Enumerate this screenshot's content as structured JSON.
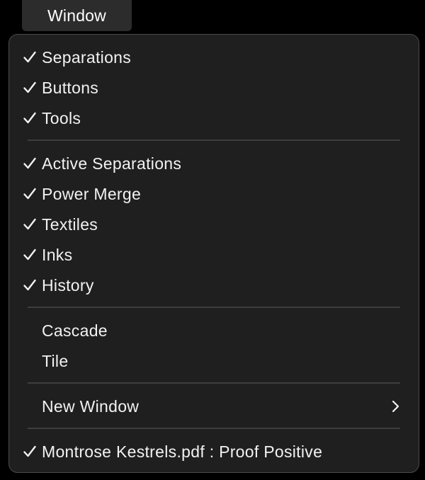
{
  "menubar": {
    "title": "Window"
  },
  "menu": {
    "group1": [
      {
        "label": "Separations",
        "checked": true
      },
      {
        "label": "Buttons",
        "checked": true
      },
      {
        "label": "Tools",
        "checked": true
      }
    ],
    "group2": [
      {
        "label": "Active Separations",
        "checked": true
      },
      {
        "label": "Power Merge",
        "checked": true
      },
      {
        "label": "Textiles",
        "checked": true
      },
      {
        "label": "Inks",
        "checked": true
      },
      {
        "label": "History",
        "checked": true
      }
    ],
    "group3": [
      {
        "label": "Cascade",
        "checked": false
      },
      {
        "label": "Tile",
        "checked": false
      }
    ],
    "group4": [
      {
        "label": "New Window",
        "checked": false,
        "has_submenu": true
      }
    ],
    "group5": [
      {
        "label": "Montrose Kestrels.pdf : Proof Positive",
        "checked": true
      }
    ]
  },
  "icons": {
    "checkmark": "checkmark-icon",
    "submenu": "chevron-right-icon"
  },
  "colors": {
    "background": "#000000",
    "menu_background": "#1f1f1f",
    "menu_border": "#4a4a4a",
    "title_background": "#2c2c2c",
    "separator": "#3d3d3d",
    "text": "#f2f2f2"
  }
}
